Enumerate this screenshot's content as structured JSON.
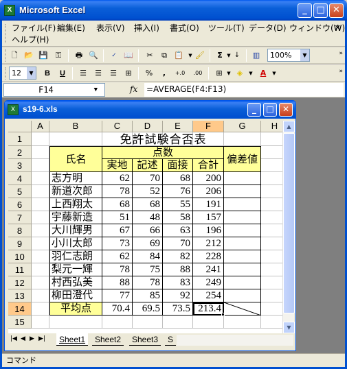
{
  "app": {
    "title": "Microsoft Excel",
    "icon": "excel-icon"
  },
  "menu": [
    "ファイル(F)",
    "編集(E)",
    "表示(V)",
    "挿入(I)",
    "書式(O)",
    "ツール(T)",
    "データ(D)",
    "ウィンドウ(W)",
    "ヘルプ(H)"
  ],
  "toolbar": {
    "zoom": "100%",
    "font_size": "12",
    "sum_symbol": "Σ",
    "bold": "B",
    "underline": "U",
    "percent": "%",
    "comma": ",",
    "inc_decimal": "+.0",
    "dec_decimal": ".00",
    "font_color_letter": "A"
  },
  "formula_bar": {
    "name_box": "F14",
    "fx": "fx",
    "formula": "=AVERAGE(F4:F13)"
  },
  "workbook": {
    "title": "s19-6.xls",
    "columns": [
      "A",
      "B",
      "C",
      "D",
      "E",
      "F",
      "G",
      "H"
    ],
    "rows": [
      "1",
      "2",
      "3",
      "4",
      "5",
      "6",
      "7",
      "8",
      "9",
      "10",
      "11",
      "12",
      "13",
      "14",
      "15"
    ],
    "title_cell": "免許試験合否表",
    "header": {
      "name": "氏名",
      "points": "点数",
      "practical": "実地",
      "written": "記述",
      "interview": "面接",
      "total": "合計",
      "deviation": "偏差値"
    },
    "records": [
      {
        "name": "志方明",
        "practical": "62",
        "written": "70",
        "interview": "68",
        "total": "200"
      },
      {
        "name": "新道次郎",
        "practical": "78",
        "written": "52",
        "interview": "76",
        "total": "206"
      },
      {
        "name": "上西翔太",
        "practical": "68",
        "written": "68",
        "interview": "55",
        "total": "191"
      },
      {
        "name": "宇藤新造",
        "practical": "51",
        "written": "48",
        "interview": "58",
        "total": "157"
      },
      {
        "name": "大川輝男",
        "practical": "67",
        "written": "66",
        "interview": "63",
        "total": "196"
      },
      {
        "name": "小川太郎",
        "practical": "73",
        "written": "69",
        "interview": "70",
        "total": "212"
      },
      {
        "name": "羽仁志朗",
        "practical": "62",
        "written": "84",
        "interview": "82",
        "total": "228"
      },
      {
        "name": "梨元一輝",
        "practical": "78",
        "written": "75",
        "interview": "88",
        "total": "241"
      },
      {
        "name": "村西弘美",
        "practical": "88",
        "written": "78",
        "interview": "83",
        "total": "249"
      },
      {
        "name": "柳田澄代",
        "practical": "77",
        "written": "85",
        "interview": "92",
        "total": "254"
      }
    ],
    "average": {
      "label": "平均点",
      "practical": "70.4",
      "written": "69.5",
      "interview": "73.5",
      "total": "213.4"
    },
    "sheets": [
      "Sheet1",
      "Sheet2",
      "Sheet3",
      "S"
    ],
    "active_sheet": "Sheet1",
    "highlight_color": "#ffff99",
    "active_header_color": "#ffc98a"
  },
  "status": "コマンド"
}
